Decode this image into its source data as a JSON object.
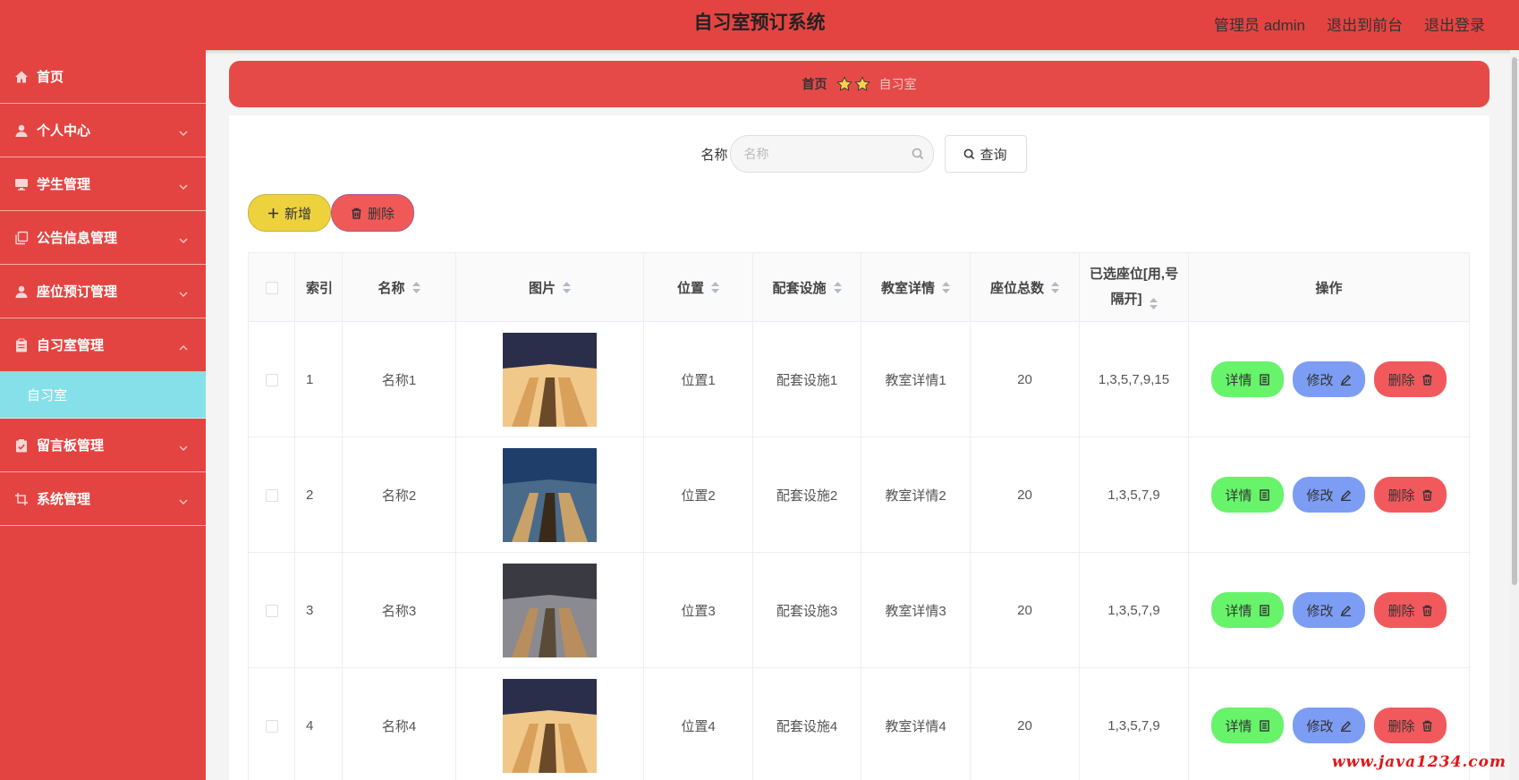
{
  "header": {
    "title": "自习室预订系统",
    "admin_label": "管理员 admin",
    "front_label": "退出到前台",
    "logout_label": "退出登录"
  },
  "sidebar": {
    "items": [
      {
        "label": "首页",
        "icon": "home-icon"
      },
      {
        "label": "个人中心",
        "icon": "user-icon"
      },
      {
        "label": "学生管理",
        "icon": "monitor-icon"
      },
      {
        "label": "公告信息管理",
        "icon": "copy-icon"
      },
      {
        "label": "座位预订管理",
        "icon": "user-icon"
      },
      {
        "label": "自习室管理",
        "icon": "clipboard-icon"
      },
      {
        "label": "留言板管理",
        "icon": "clipboard-check-icon"
      },
      {
        "label": "系统管理",
        "icon": "crop-icon"
      }
    ],
    "active_sub": "自习室"
  },
  "breadcrumb": {
    "home": "首页",
    "current": "自习室"
  },
  "search": {
    "label": "名称",
    "placeholder": "名称",
    "value": "",
    "button": "查询"
  },
  "toolbar": {
    "add_label": "新增",
    "delete_label": "删除"
  },
  "table": {
    "columns": [
      "索引",
      "名称",
      "图片",
      "位置",
      "配套设施",
      "教室详情",
      "座位总数",
      "已选座位[用,号隔开]",
      "操作"
    ],
    "rows": [
      {
        "index": "1",
        "name": "名称1",
        "image": "study-room-photo",
        "location": "位置1",
        "facility": "配套设施1",
        "detail": "教室详情1",
        "seats": "20",
        "selected": "1,3,5,7,9,15"
      },
      {
        "index": "2",
        "name": "名称2",
        "image": "study-room-photo",
        "location": "位置2",
        "facility": "配套设施2",
        "detail": "教室详情2",
        "seats": "20",
        "selected": "1,3,5,7,9"
      },
      {
        "index": "3",
        "name": "名称3",
        "image": "study-room-photo",
        "location": "位置3",
        "facility": "配套设施3",
        "detail": "教室详情3",
        "seats": "20",
        "selected": "1,3,5,7,9"
      },
      {
        "index": "4",
        "name": "名称4",
        "image": "study-room-photo",
        "location": "位置4",
        "facility": "配套设施4",
        "detail": "教室详情4",
        "seats": "20",
        "selected": "1,3,5,7,9"
      }
    ],
    "ops": {
      "detail": "详情",
      "edit": "修改",
      "remove": "删除"
    }
  },
  "watermark": "www.java1234.com",
  "colors": {
    "primary_red": "#e44441",
    "submenu_cyan": "#86e0e9",
    "add_yellow": "#edd23e",
    "detail_green": "#67f36a",
    "edit_blue": "#7d9df4",
    "delete_red": "#f2595d"
  }
}
